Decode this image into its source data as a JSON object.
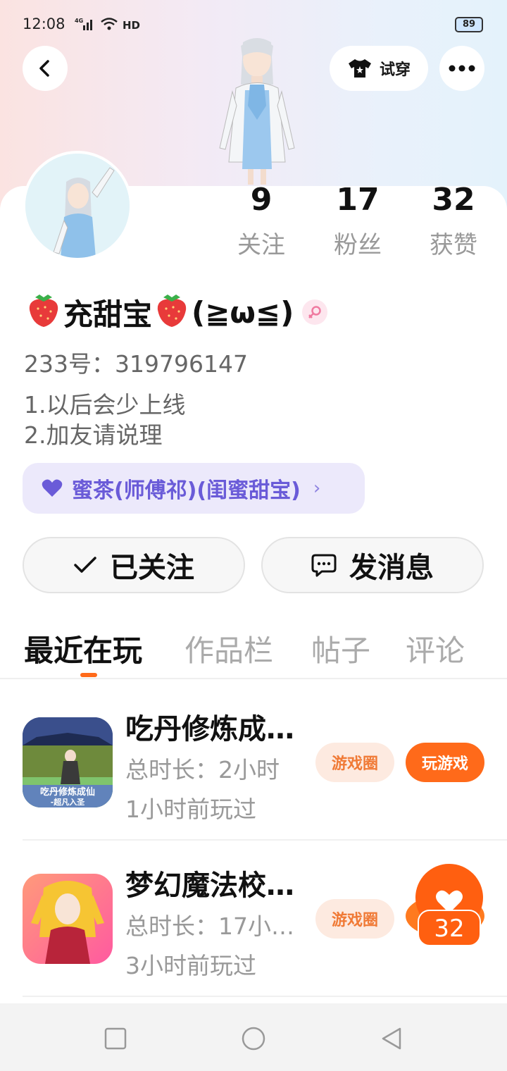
{
  "status_bar": {
    "time": "12:08",
    "network": "4G",
    "hd": "HD",
    "battery": "89"
  },
  "header": {
    "tryon_label": "试穿"
  },
  "stats": [
    {
      "value": "9",
      "label": "关注"
    },
    {
      "value": "17",
      "label": "粉丝"
    },
    {
      "value": "32",
      "label": "获赞"
    }
  ],
  "profile": {
    "nickname_emoji": "🍓",
    "nickname_main": "充甜宝",
    "nickname_tail": "(≧ω≦)",
    "uid": "233号：319796147",
    "bio_line1": "1.以后会少上线",
    "bio_line2": "2.加友请说理",
    "relation": "蜜茶(师傅祁)(闺蜜甜宝)"
  },
  "actions": {
    "followed": "已关注",
    "message": "发消息"
  },
  "tabs": [
    "最近在玩",
    "作品栏",
    "帖子",
    "评论"
  ],
  "games": [
    {
      "title": "吃丹修炼成…",
      "duration": "总时长：2小时",
      "last_played": "1小时前玩过",
      "circle": "游戏圈",
      "play": "玩游戏",
      "icon_caption": "吃丹修炼成仙",
      "icon_sub": "-超凡入圣"
    },
    {
      "title": "梦幻魔法校…",
      "duration": "总时长：17小…",
      "last_played": "3小时前玩过",
      "circle": "游戏圈"
    }
  ],
  "like_float": {
    "count": "32"
  },
  "colors": {
    "accent": "#ff6a1a",
    "relation_purple": "#6a5bd8",
    "gray_text": "#999999"
  }
}
